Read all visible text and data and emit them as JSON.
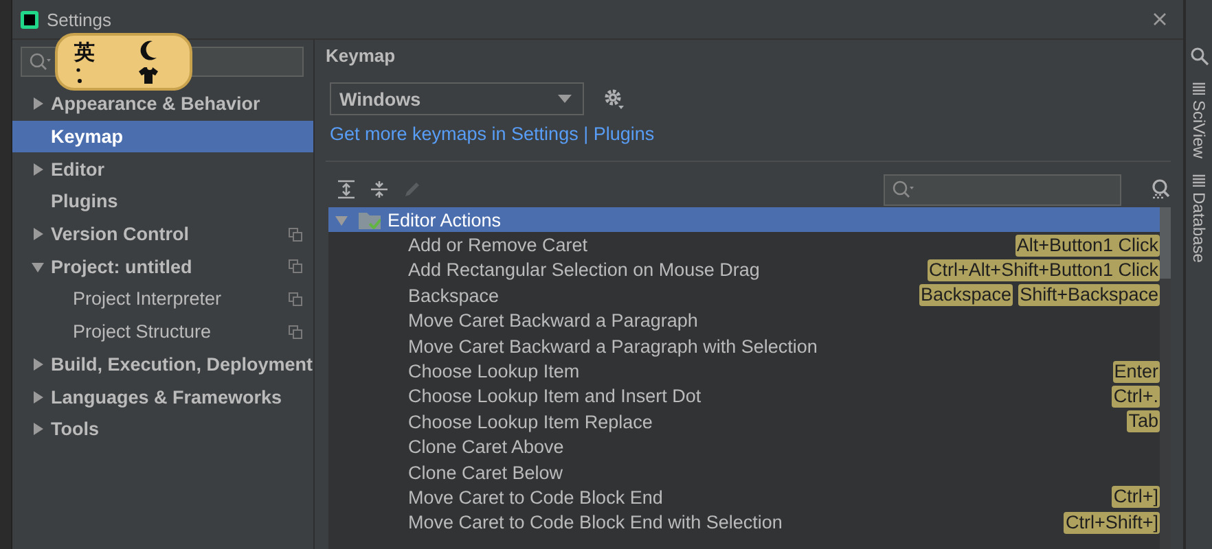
{
  "window": {
    "title": "Settings"
  },
  "ime_bar": {
    "mode": "英"
  },
  "sidebar": {
    "items": [
      {
        "label": "Appearance & Behavior",
        "expanded": false,
        "selected": false,
        "project_level": false
      },
      {
        "label": "Keymap",
        "selected": true,
        "project_level": false
      },
      {
        "label": "Editor",
        "expanded": false,
        "selected": false,
        "project_level": false
      },
      {
        "label": "Plugins",
        "selected": false,
        "project_level": false
      },
      {
        "label": "Version Control",
        "expanded": false,
        "selected": false,
        "project_level": true
      },
      {
        "label": "Project: untitled",
        "expanded": true,
        "selected": false,
        "project_level": true,
        "children": [
          {
            "label": "Project Interpreter",
            "selected": false,
            "project_level": true
          },
          {
            "label": "Project Structure",
            "selected": false,
            "project_level": true
          }
        ]
      },
      {
        "label": "Build, Execution, Deployment",
        "expanded": false,
        "selected": false,
        "project_level": false
      },
      {
        "label": "Languages & Frameworks",
        "expanded": false,
        "selected": false,
        "project_level": false
      },
      {
        "label": "Tools",
        "expanded": false,
        "selected": false,
        "project_level": false
      }
    ]
  },
  "keymap": {
    "title": "Keymap",
    "scheme": "Windows",
    "link": "Get more keymaps in Settings | Plugins",
    "tree": [
      {
        "label": "Editor Actions",
        "expanded": true,
        "selected": true,
        "children": [
          {
            "label": "Add or Remove Caret",
            "selected": false,
            "shortcuts": [
              "Alt+Button1 Click"
            ]
          },
          {
            "label": "Add Rectangular Selection on Mouse Drag",
            "selected": false,
            "shortcuts": [
              "Ctrl+Alt+Shift+Button1 Click"
            ]
          },
          {
            "label": "Backspace",
            "selected": false,
            "shortcuts": [
              "Backspace",
              "Shift+Backspace"
            ]
          },
          {
            "label": "Move Caret Backward a Paragraph",
            "selected": false
          },
          {
            "label": "Move Caret Backward a Paragraph with Selection",
            "selected": false
          },
          {
            "label": "Choose Lookup Item",
            "selected": false,
            "shortcuts": [
              "Enter"
            ]
          },
          {
            "label": "Choose Lookup Item and Insert Dot",
            "selected": false,
            "shortcuts": [
              "Ctrl+."
            ]
          },
          {
            "label": "Choose Lookup Item Replace",
            "selected": false,
            "shortcuts": [
              "Tab"
            ]
          },
          {
            "label": "Clone Caret Above",
            "selected": false
          },
          {
            "label": "Clone Caret Below",
            "selected": false
          },
          {
            "label": "Move Caret to Code Block End",
            "selected": false,
            "shortcuts": [
              "Ctrl+]"
            ]
          },
          {
            "label": "Move Caret to Code Block End with Selection",
            "selected": false,
            "shortcuts": [
              "Ctrl+Shift+]"
            ]
          }
        ]
      }
    ]
  },
  "tool_strip": {
    "items": [
      "SciView",
      "Database"
    ]
  }
}
